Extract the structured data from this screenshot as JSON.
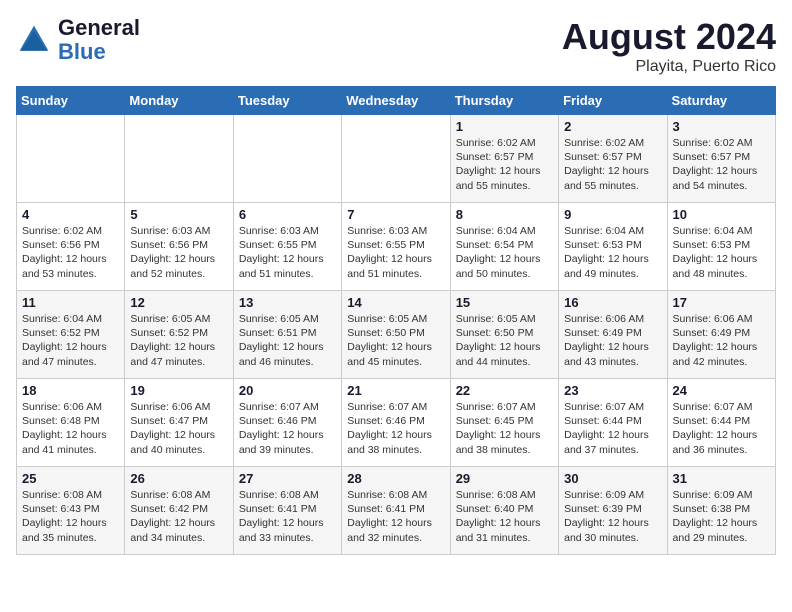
{
  "header": {
    "logo_general": "General",
    "logo_blue": "Blue",
    "month_year": "August 2024",
    "location": "Playita, Puerto Rico"
  },
  "days_of_week": [
    "Sunday",
    "Monday",
    "Tuesday",
    "Wednesday",
    "Thursday",
    "Friday",
    "Saturday"
  ],
  "weeks": [
    [
      {
        "day": "",
        "info": ""
      },
      {
        "day": "",
        "info": ""
      },
      {
        "day": "",
        "info": ""
      },
      {
        "day": "",
        "info": ""
      },
      {
        "day": "1",
        "info": "Sunrise: 6:02 AM\nSunset: 6:57 PM\nDaylight: 12 hours\nand 55 minutes."
      },
      {
        "day": "2",
        "info": "Sunrise: 6:02 AM\nSunset: 6:57 PM\nDaylight: 12 hours\nand 55 minutes."
      },
      {
        "day": "3",
        "info": "Sunrise: 6:02 AM\nSunset: 6:57 PM\nDaylight: 12 hours\nand 54 minutes."
      }
    ],
    [
      {
        "day": "4",
        "info": "Sunrise: 6:02 AM\nSunset: 6:56 PM\nDaylight: 12 hours\nand 53 minutes."
      },
      {
        "day": "5",
        "info": "Sunrise: 6:03 AM\nSunset: 6:56 PM\nDaylight: 12 hours\nand 52 minutes."
      },
      {
        "day": "6",
        "info": "Sunrise: 6:03 AM\nSunset: 6:55 PM\nDaylight: 12 hours\nand 51 minutes."
      },
      {
        "day": "7",
        "info": "Sunrise: 6:03 AM\nSunset: 6:55 PM\nDaylight: 12 hours\nand 51 minutes."
      },
      {
        "day": "8",
        "info": "Sunrise: 6:04 AM\nSunset: 6:54 PM\nDaylight: 12 hours\nand 50 minutes."
      },
      {
        "day": "9",
        "info": "Sunrise: 6:04 AM\nSunset: 6:53 PM\nDaylight: 12 hours\nand 49 minutes."
      },
      {
        "day": "10",
        "info": "Sunrise: 6:04 AM\nSunset: 6:53 PM\nDaylight: 12 hours\nand 48 minutes."
      }
    ],
    [
      {
        "day": "11",
        "info": "Sunrise: 6:04 AM\nSunset: 6:52 PM\nDaylight: 12 hours\nand 47 minutes."
      },
      {
        "day": "12",
        "info": "Sunrise: 6:05 AM\nSunset: 6:52 PM\nDaylight: 12 hours\nand 47 minutes."
      },
      {
        "day": "13",
        "info": "Sunrise: 6:05 AM\nSunset: 6:51 PM\nDaylight: 12 hours\nand 46 minutes."
      },
      {
        "day": "14",
        "info": "Sunrise: 6:05 AM\nSunset: 6:50 PM\nDaylight: 12 hours\nand 45 minutes."
      },
      {
        "day": "15",
        "info": "Sunrise: 6:05 AM\nSunset: 6:50 PM\nDaylight: 12 hours\nand 44 minutes."
      },
      {
        "day": "16",
        "info": "Sunrise: 6:06 AM\nSunset: 6:49 PM\nDaylight: 12 hours\nand 43 minutes."
      },
      {
        "day": "17",
        "info": "Sunrise: 6:06 AM\nSunset: 6:49 PM\nDaylight: 12 hours\nand 42 minutes."
      }
    ],
    [
      {
        "day": "18",
        "info": "Sunrise: 6:06 AM\nSunset: 6:48 PM\nDaylight: 12 hours\nand 41 minutes."
      },
      {
        "day": "19",
        "info": "Sunrise: 6:06 AM\nSunset: 6:47 PM\nDaylight: 12 hours\nand 40 minutes."
      },
      {
        "day": "20",
        "info": "Sunrise: 6:07 AM\nSunset: 6:46 PM\nDaylight: 12 hours\nand 39 minutes."
      },
      {
        "day": "21",
        "info": "Sunrise: 6:07 AM\nSunset: 6:46 PM\nDaylight: 12 hours\nand 38 minutes."
      },
      {
        "day": "22",
        "info": "Sunrise: 6:07 AM\nSunset: 6:45 PM\nDaylight: 12 hours\nand 38 minutes."
      },
      {
        "day": "23",
        "info": "Sunrise: 6:07 AM\nSunset: 6:44 PM\nDaylight: 12 hours\nand 37 minutes."
      },
      {
        "day": "24",
        "info": "Sunrise: 6:07 AM\nSunset: 6:44 PM\nDaylight: 12 hours\nand 36 minutes."
      }
    ],
    [
      {
        "day": "25",
        "info": "Sunrise: 6:08 AM\nSunset: 6:43 PM\nDaylight: 12 hours\nand 35 minutes."
      },
      {
        "day": "26",
        "info": "Sunrise: 6:08 AM\nSunset: 6:42 PM\nDaylight: 12 hours\nand 34 minutes."
      },
      {
        "day": "27",
        "info": "Sunrise: 6:08 AM\nSunset: 6:41 PM\nDaylight: 12 hours\nand 33 minutes."
      },
      {
        "day": "28",
        "info": "Sunrise: 6:08 AM\nSunset: 6:41 PM\nDaylight: 12 hours\nand 32 minutes."
      },
      {
        "day": "29",
        "info": "Sunrise: 6:08 AM\nSunset: 6:40 PM\nDaylight: 12 hours\nand 31 minutes."
      },
      {
        "day": "30",
        "info": "Sunrise: 6:09 AM\nSunset: 6:39 PM\nDaylight: 12 hours\nand 30 minutes."
      },
      {
        "day": "31",
        "info": "Sunrise: 6:09 AM\nSunset: 6:38 PM\nDaylight: 12 hours\nand 29 minutes."
      }
    ]
  ]
}
